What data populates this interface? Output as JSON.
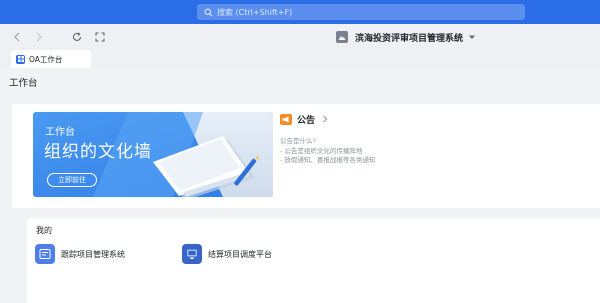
{
  "search": {
    "placeholder": "搜索 (Ctrl+Shift+F)"
  },
  "system": {
    "name": "滨海投资评审项目管理系统"
  },
  "tab": {
    "label": "OA工作台"
  },
  "page": {
    "title": "工作台"
  },
  "banner": {
    "small_title": "工作台",
    "big_title": "组织的文化墙",
    "button": "立即前往"
  },
  "notice": {
    "title": "公告",
    "lines": [
      "公告是什么?",
      "- 公告是组织文化的传播阵地",
      "- 放假通知、喜报战报等各类通知"
    ]
  },
  "mine": {
    "title": "我的",
    "apps": [
      {
        "name": "跟踪项目管理系统"
      },
      {
        "name": "结算项目调度平台"
      }
    ]
  },
  "colors": {
    "accent": "#2b6de6",
    "notice": "#f38c2c",
    "app1": "#4e7fe8",
    "app2": "#3a63c7"
  },
  "icons": [
    "search-icon",
    "back-icon",
    "forward-icon",
    "refresh-icon",
    "fullscreen-icon",
    "system-logo-icon",
    "caret-down-icon",
    "grid-icon",
    "megaphone-icon",
    "chevron-right-icon",
    "app-tracking-icon",
    "app-settlement-icon"
  ]
}
